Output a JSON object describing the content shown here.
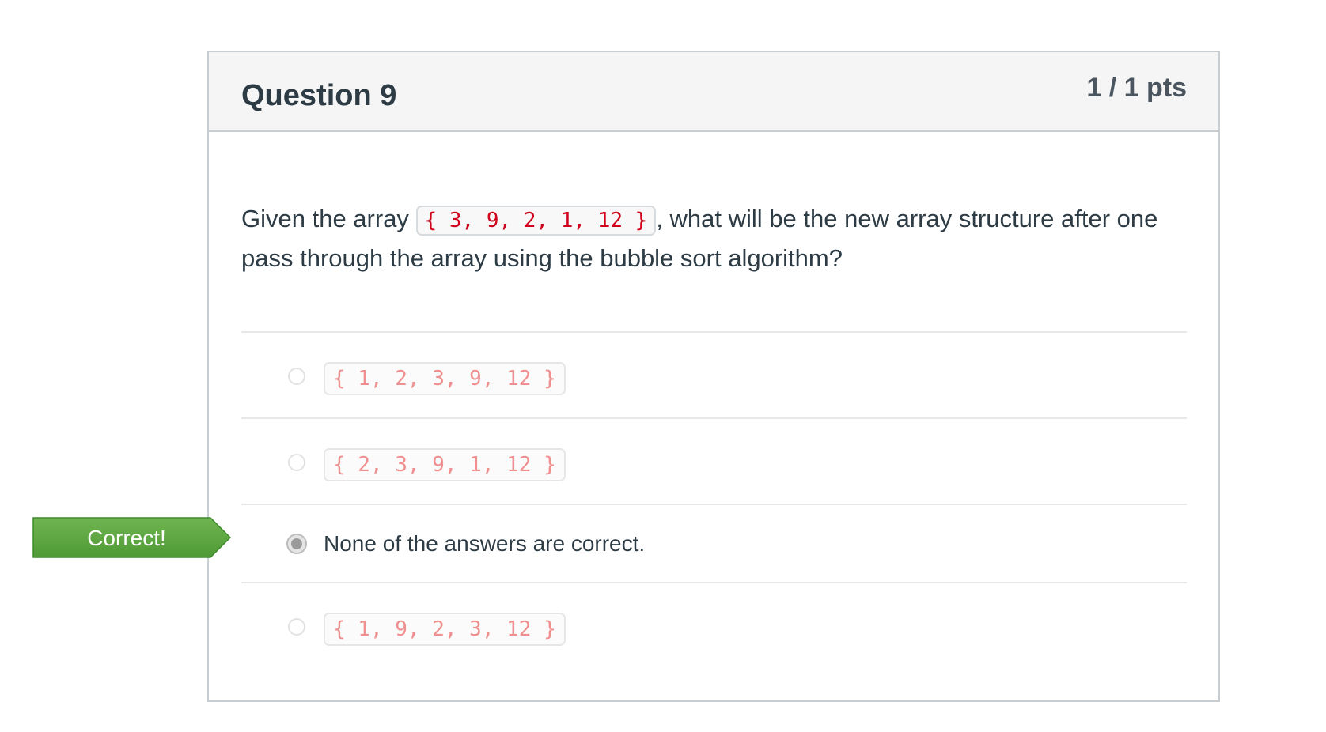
{
  "question": {
    "title": "Question 9",
    "points": "1 / 1 pts",
    "text_before": "Given the array ",
    "array_code": "{ 3, 9, 2, 1, 12 }",
    "text_after": ", what will be the new array structure after one pass through the array using the bubble sort algorithm?"
  },
  "answers": [
    {
      "label": "{ 1, 2, 3, 9, 12 }",
      "selected": false,
      "is_code": true
    },
    {
      "label": "{ 2, 3, 9, 1, 12 }",
      "selected": false,
      "is_code": true
    },
    {
      "label": "None of the answers are correct.",
      "selected": true,
      "is_code": false
    },
    {
      "label": "{ 1, 9, 2, 3, 12 }",
      "selected": false,
      "is_code": true
    }
  ],
  "feedback": {
    "label": "Correct!",
    "color": "#6ab04c"
  }
}
